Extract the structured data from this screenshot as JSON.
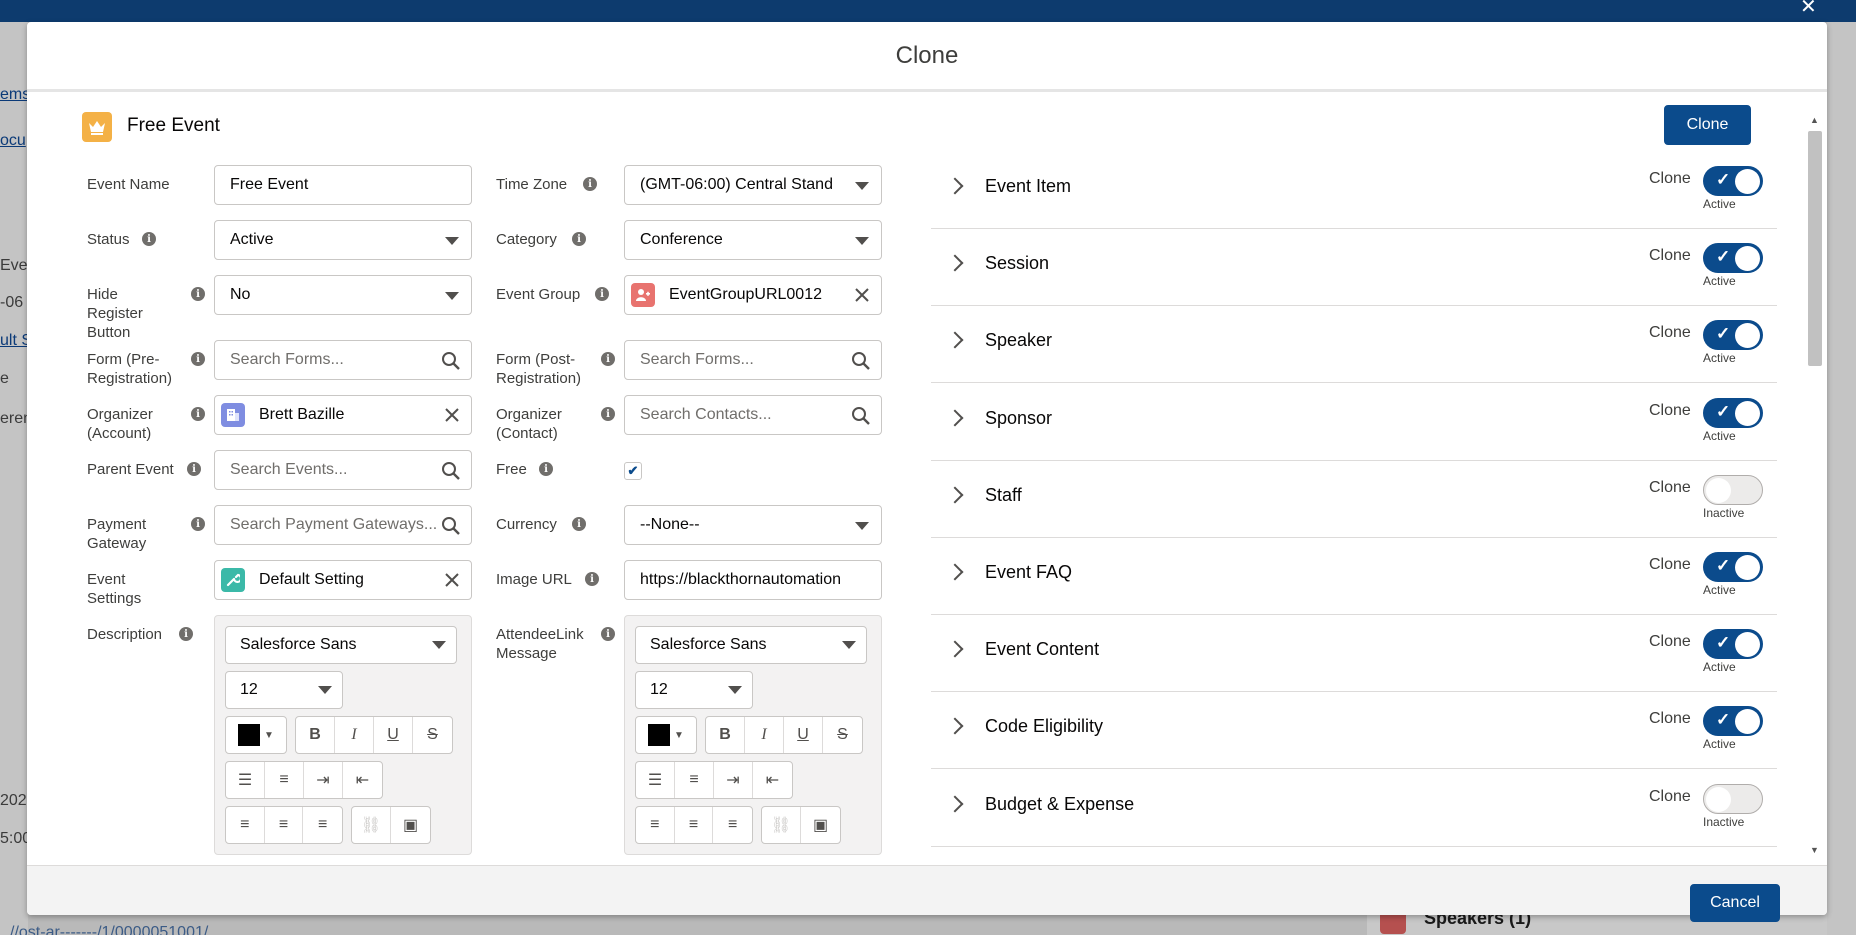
{
  "background": {
    "left_fragments": [
      "ems",
      "ocu",
      "Ever",
      "-06",
      "ult S",
      "e",
      "eren",
      "202",
      "5:00"
    ],
    "speakers_label": "Speakers (1)",
    "bottom_link": "//ost-ar-------/1/0000051001/"
  },
  "modal": {
    "title": "Clone",
    "record_title": "Free Event",
    "clone_button": "Clone",
    "cancel_button": "Cancel"
  },
  "form": {
    "event_name": {
      "label": "Event Name",
      "value": "Free Event"
    },
    "time_zone": {
      "label": "Time Zone",
      "value": "(GMT-06:00) Central Stand"
    },
    "status": {
      "label": "Status",
      "value": "Active"
    },
    "category": {
      "label": "Category",
      "value": "Conference"
    },
    "hide_register": {
      "label": "Hide Register Button",
      "value": "No"
    },
    "event_group": {
      "label": "Event Group",
      "value": "EventGroupURL0012"
    },
    "form_pre": {
      "label": "Form (Pre-Registration)",
      "placeholder": "Search Forms..."
    },
    "form_post": {
      "label": "Form (Post-Registration)",
      "placeholder": "Search Forms..."
    },
    "organizer_account": {
      "label": "Organizer (Account)",
      "value": "Brett Bazille"
    },
    "organizer_contact": {
      "label": "Organizer (Contact)",
      "placeholder": "Search Contacts..."
    },
    "parent_event": {
      "label": "Parent Event",
      "placeholder": "Search Events..."
    },
    "free": {
      "label": "Free",
      "checked": true
    },
    "payment_gateway": {
      "label": "Payment Gateway",
      "placeholder": "Search Payment Gateways..."
    },
    "currency": {
      "label": "Currency",
      "value": "--None--"
    },
    "event_settings": {
      "label": "Event Settings",
      "value": "Default Setting"
    },
    "image_url": {
      "label": "Image URL",
      "value": "https://blackthornautomation"
    },
    "description": {
      "label": "Description",
      "font": "Salesforce Sans",
      "size": "12"
    },
    "attendee_link": {
      "label": "AttendeeLink Message",
      "font": "Salesforce Sans",
      "size": "12"
    }
  },
  "sections": [
    {
      "label": "Event Item",
      "clone": "Clone",
      "state": "Active",
      "on": true
    },
    {
      "label": "Session",
      "clone": "Clone",
      "state": "Active",
      "on": true
    },
    {
      "label": "Speaker",
      "clone": "Clone",
      "state": "Active",
      "on": true
    },
    {
      "label": "Sponsor",
      "clone": "Clone",
      "state": "Active",
      "on": true
    },
    {
      "label": "Staff",
      "clone": "Clone",
      "state": "Inactive",
      "on": false
    },
    {
      "label": "Event FAQ",
      "clone": "Clone",
      "state": "Active",
      "on": true
    },
    {
      "label": "Event Content",
      "clone": "Clone",
      "state": "Active",
      "on": true
    },
    {
      "label": "Code Eligibility",
      "clone": "Clone",
      "state": "Active",
      "on": true
    },
    {
      "label": "Budget & Expense",
      "clone": "Clone",
      "state": "Inactive",
      "on": false
    }
  ],
  "colors": {
    "brand": "#0b4b8c",
    "record_icon": "#f4b146",
    "event_group_icon": "#e8736f",
    "account_icon": "#7f8de1",
    "settings_icon": "#3bb9a8"
  },
  "icons": {
    "record": "crown-icon",
    "search": "search-icon",
    "clear": "close-icon",
    "info": "info-icon",
    "chevron": "chevron-right-icon"
  }
}
